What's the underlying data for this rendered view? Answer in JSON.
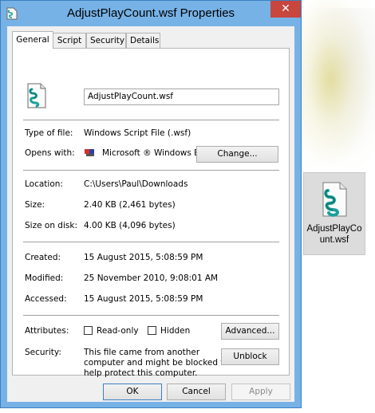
{
  "window": {
    "title": "AdjustPlayCount.wsf Properties",
    "close_glyph": "✕"
  },
  "tabs": [
    {
      "label": "General",
      "active": true
    },
    {
      "label": "Script",
      "active": false
    },
    {
      "label": "Security",
      "active": false
    },
    {
      "label": "Details",
      "active": false
    }
  ],
  "general": {
    "filename": "AdjustPlayCount.wsf",
    "type_label": "Type of file:",
    "type_value": "Windows Script File (.wsf)",
    "opens_label": "Opens with:",
    "opens_value": "Microsoft ® Windows B",
    "change_button": "Change...",
    "location_label": "Location:",
    "location_value": "C:\\Users\\Paul\\Downloads",
    "size_label": "Size:",
    "size_value": "2.40 KB (2,461 bytes)",
    "size_on_disk_label": "Size on disk:",
    "size_on_disk_value": "4.00 KB (4,096 bytes)",
    "created_label": "Created:",
    "created_value": "15 August 2015, 5:08:59 PM",
    "modified_label": "Modified:",
    "modified_value": "25 November 2010, 9:08:01 AM",
    "accessed_label": "Accessed:",
    "accessed_value": "15 August 2015, 5:08:59 PM",
    "attributes_label": "Attributes:",
    "readonly_label": "Read-only",
    "readonly_checked": false,
    "hidden_label": "Hidden",
    "hidden_checked": false,
    "advanced_button": "Advanced...",
    "security_label": "Security:",
    "security_line1": "This file came from another",
    "security_line2": "computer and might be blocked to",
    "security_line3": "help protect this computer.",
    "unblock_button": "Unblock"
  },
  "footer": {
    "ok": "OK",
    "cancel": "Cancel",
    "apply": "Apply",
    "apply_enabled": false
  },
  "desktop": {
    "file_label": "AdjustPlayCount.wsf",
    "file_icon": "script-file-icon"
  },
  "colors": {
    "titlebar": "#77b2e6",
    "close": "#c7463e"
  }
}
